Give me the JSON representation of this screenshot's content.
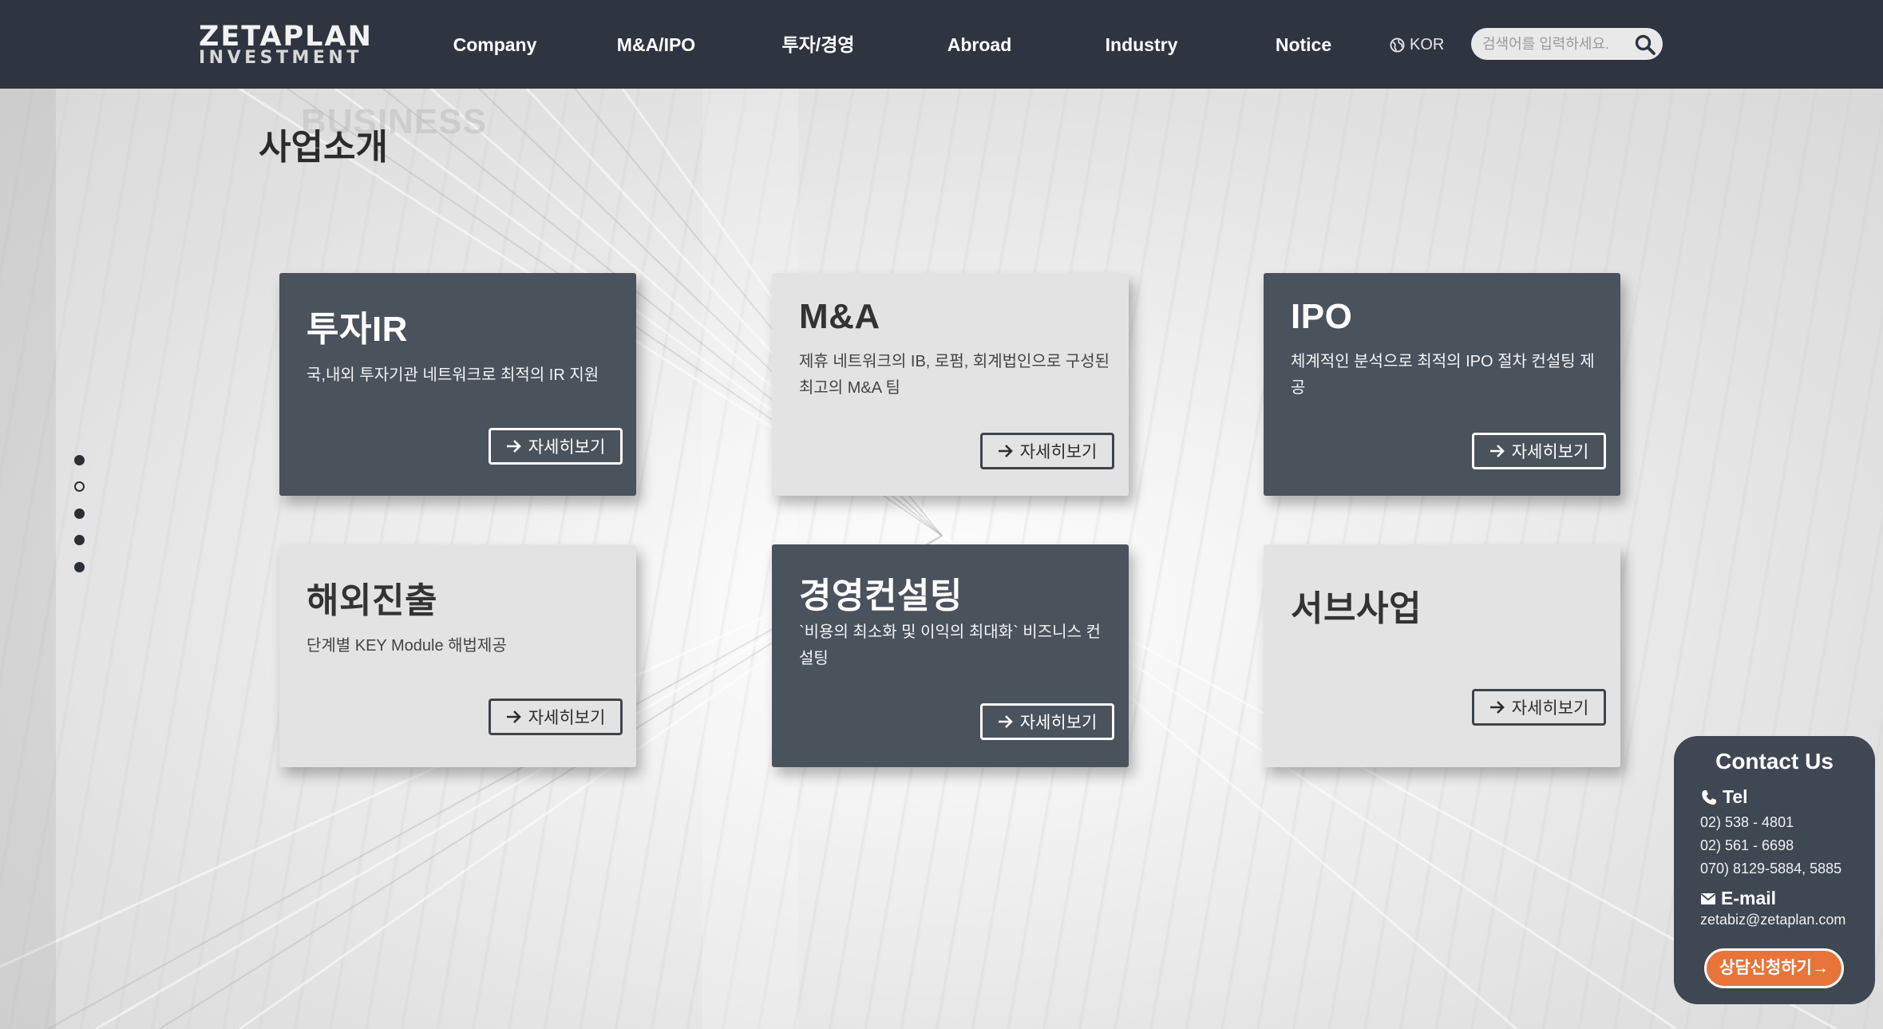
{
  "header": {
    "logo_line1": "ZETAPLAN",
    "logo_line2": "INVESTMENT",
    "nav": [
      "Company",
      "M&A/IPO",
      "투자/경영",
      "Abroad",
      "Industry",
      "Notice"
    ],
    "lang": "KOR",
    "search_placeholder": "검색어를 입력하세요."
  },
  "page": {
    "title": "사업소개",
    "title_ghost": "BUSINESS"
  },
  "pager": {
    "count": 5,
    "active_index": 1
  },
  "cards": [
    {
      "title": "투자IR",
      "desc": "국,내외 투자기관 네트워크로 최적의 IR 지원",
      "button": "자세히보기",
      "style": "dark"
    },
    {
      "title": "M&A",
      "desc": "제휴 네트워크의 IB, 로펌, 회계법인으로 구성된 최고의 M&A 팀",
      "button": "자세히보기",
      "style": "light"
    },
    {
      "title": "IPO",
      "desc": "체계적인 분석으로 최적의 IPO 절차 컨설팅 제공",
      "button": "자세히보기",
      "style": "dark"
    },
    {
      "title": "해외진출",
      "desc": "단계별 KEY Module 해법제공",
      "button": "자세히보기",
      "style": "light"
    },
    {
      "title": "경영컨설팅",
      "desc": "`비용의 최소화 및 이익의 최대화` 비즈니스 컨설팅",
      "button": "자세히보기",
      "style": "dark"
    },
    {
      "title": "서브사업",
      "desc": "",
      "button": "자세히보기",
      "style": "light"
    }
  ],
  "contact": {
    "title": "Contact Us",
    "tel_label": "Tel",
    "tel": [
      "02) 538 - 4801",
      "02) 561 - 6698",
      "070) 8129-5884, 5885"
    ],
    "email_label": "E-mail",
    "email": "zetabiz@zetaplan.com",
    "button": "상담신청하기"
  },
  "colors": {
    "header_bg": "#2e3540",
    "card_dark": "#4a525c",
    "card_light": "#e3e3e3",
    "contact_bg": "#3f4753",
    "accent_orange": "#e8743a"
  }
}
